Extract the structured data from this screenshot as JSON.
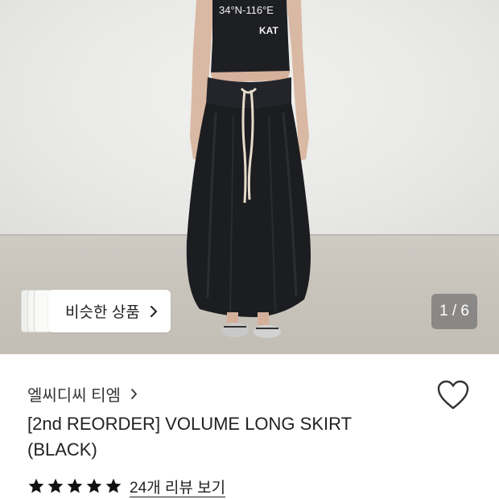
{
  "photo": {
    "shirt_text_top": "34°N-116°E",
    "shirt_text_bottom": "KAT",
    "similar_items_label": "비슷한 상품",
    "image_counter": "1 / 6"
  },
  "product": {
    "brand": "엘씨디씨 티엠",
    "title": "[2nd REORDER] VOLUME LONG SKIRT (BLACK)",
    "rating_stars": 5,
    "review_link": "24개 리뷰 보기"
  },
  "colors": {
    "skirt": "#1c1d21",
    "star": "#111111",
    "counter_bg": "#7a7a7a"
  },
  "icons": {
    "wishlist": "heart-outline-icon",
    "chevron": "chevron-right-icon",
    "star": "star-filled-icon"
  }
}
